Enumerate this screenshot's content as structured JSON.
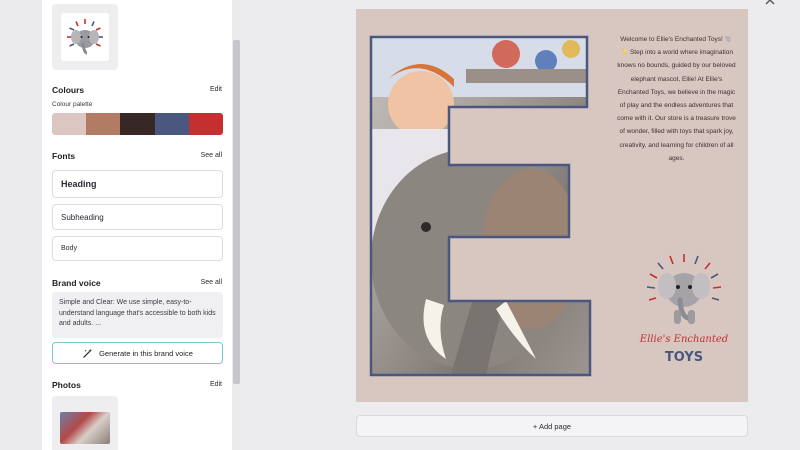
{
  "panel": {
    "colours": {
      "title": "Colours",
      "edit_label": "Edit",
      "palette_label": "Colour palette",
      "swatches": [
        "#dcc6c1",
        "#b27b64",
        "#372826",
        "#4a587f",
        "#c3302f"
      ]
    },
    "fonts": {
      "title": "Fonts",
      "see_all_label": "See all",
      "heading": "Heading",
      "subheading": "Subheading",
      "body": "Body"
    },
    "brand_voice": {
      "title": "Brand voice",
      "see_all_label": "See all",
      "text": "Simple and Clear: We use simple, easy-to-understand language that's accessible to both kids and adults. ...",
      "generate_label": "Generate in this brand voice"
    },
    "photos": {
      "title": "Photos",
      "edit_label": "Edit"
    }
  },
  "page": {
    "intro_text": "Welcome to Ellie's Enchanted Toys! 🐘✨ Step into a world where imagination knows no bounds, guided by our beloved elephant mascot, Ellie! At Ellie's Enchanted Toys, we believe in the magic of play and the endless adventures that come with it. Our store is a treasure trove of wonder, filled with toys that spark joy, creativity, and learning for children of all ages.",
    "logo_script": "Ellie's Enchanted",
    "logo_word": "TOYS"
  },
  "add_page_label": "+ Add page",
  "icons": [
    "magic-wand-icon",
    "elephant-logo",
    "photo-thumbnail"
  ]
}
